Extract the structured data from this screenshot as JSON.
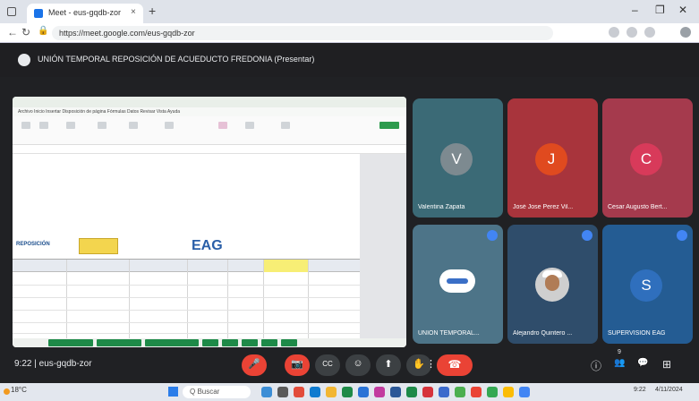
{
  "browser": {
    "tab_title": "Meet - eus-gqdb-zor",
    "tab_close": "×",
    "new_tab": "+",
    "url": "https://meet.google.com/eus-gqdb-zor",
    "window_controls": [
      "–",
      "❐",
      "✕"
    ]
  },
  "meet": {
    "presentation_title": "UNIÓN TEMPORAL REPOSICIÓN DE ACUEDUCTO FREDONIA (Presentar)",
    "meeting_time": "9:22",
    "meeting_code": "eus-gqdb-zor",
    "participants": [
      {
        "name": "Valentina Zapata",
        "initial": "V",
        "tile_color": "#3b6a76",
        "avatar_color": "#7d8a90"
      },
      {
        "name": "José Jose Perez Vil...",
        "initial": "J",
        "tile_color": "#a8343c",
        "avatar_color": "#e04a1f"
      },
      {
        "name": "Cesar Augusto Bert...",
        "initial": "C",
        "tile_color": "#a53a4d",
        "avatar_color": "#d83a5a"
      },
      {
        "name": "UNIÓN TEMPORAL...",
        "initial": "",
        "tile_color": "#4d7488",
        "avatar_color": "#ffffff"
      },
      {
        "name": "Alejandro Quintero ...",
        "initial": "",
        "tile_color": "#2f4d6b",
        "avatar_color": "#cfcfcf"
      },
      {
        "name": "SUPERVISION EAG",
        "initial": "S",
        "tile_color": "#245c93",
        "avatar_color": "#2f6fbd"
      }
    ],
    "controls": {
      "mic": "🎤",
      "camera": "📷",
      "captions": "CC",
      "emoji": "☺",
      "present": "⬆",
      "raise_hand": "✋",
      "more": "⋮",
      "end_call": "☎",
      "info": "ⓘ",
      "people": "👥",
      "chat": "💬",
      "activities": "⊞",
      "people_count": "9"
    }
  },
  "presentation": {
    "logo_main": "EAG",
    "logo_left": "REPOSICIÓN",
    "ribbon_tabs": "Archivo  Inicio  Insertar  Disposición de página  Fórmulas  Datos  Revisar  Vista  Ayuda"
  },
  "taskbar": {
    "weather": "18°C",
    "search_placeholder": "Q  Buscar",
    "time": "9:22",
    "date": "4/11/2024"
  }
}
